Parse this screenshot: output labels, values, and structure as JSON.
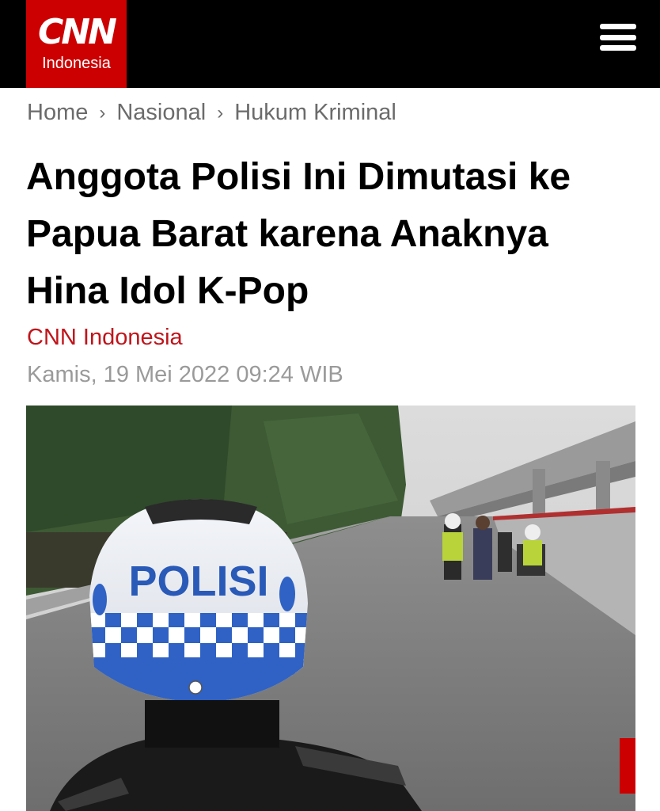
{
  "header": {
    "logo_mark": "CNN",
    "logo_sub": "Indonesia",
    "menu_icon": "hamburger-menu-icon",
    "brand_color": "#cc0000"
  },
  "breadcrumb": {
    "items": [
      "Home",
      "Nasional",
      "Hukum Kriminal"
    ],
    "separator": "›"
  },
  "article": {
    "title": "Anggota Polisi Ini Dimutasi ke Papua Barat karena Anaknya Hina Idol K-Pop",
    "source": "CNN Indonesia",
    "date": "Kamis, 19 Mei 2022 09:24 WIB",
    "source_color": "#c0141b"
  },
  "photo": {
    "helmet_text": "POLISI"
  }
}
